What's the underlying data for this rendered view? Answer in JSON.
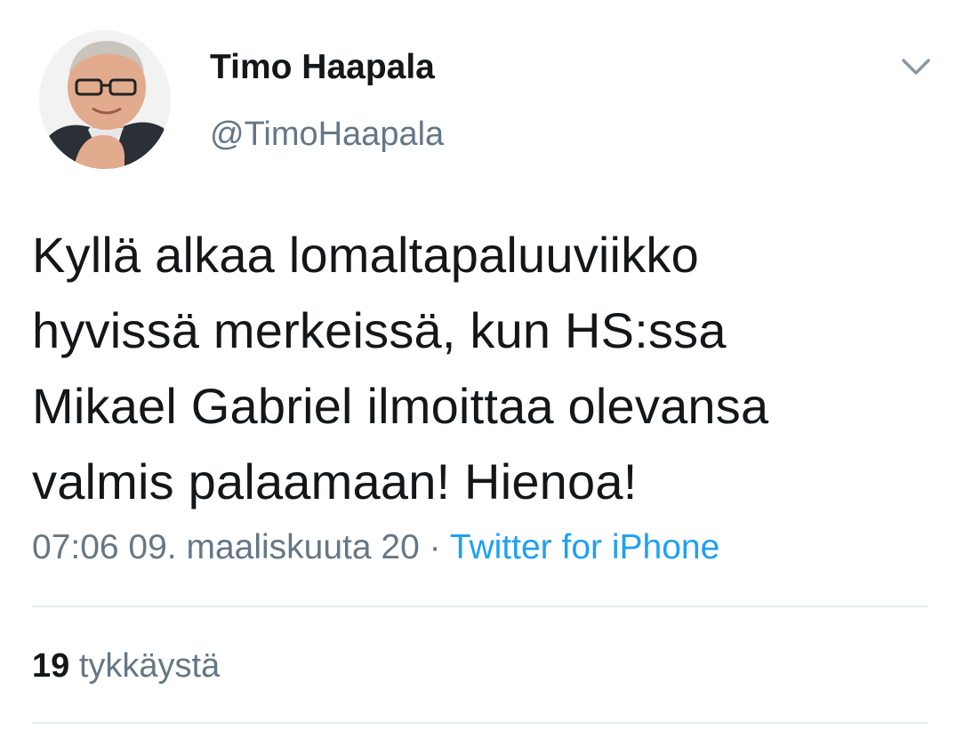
{
  "author": {
    "display_name": "Timo Haapala",
    "handle": "@TimoHaapala"
  },
  "tweet": {
    "lines": [
      "Kyllä alkaa lomaltapaluuviikko",
      "hyvissä merkeissä, kun HS:ssa",
      "Mikael Gabriel ilmoittaa olevansa",
      "valmis palaamaan! Hienoa!"
    ],
    "timestamp": "07:06 09. maaliskuuta 20",
    "separator": "·",
    "source": "Twitter for iPhone"
  },
  "engagement": {
    "likes_count": "19",
    "likes_label": "tykkäystä"
  },
  "icons": {
    "caret": "chevron-down-icon",
    "avatar": "profile-photo"
  },
  "colors": {
    "text": "#14171a",
    "secondary": "#657786",
    "link": "#1da1f2",
    "divider": "#e6ecf0"
  }
}
